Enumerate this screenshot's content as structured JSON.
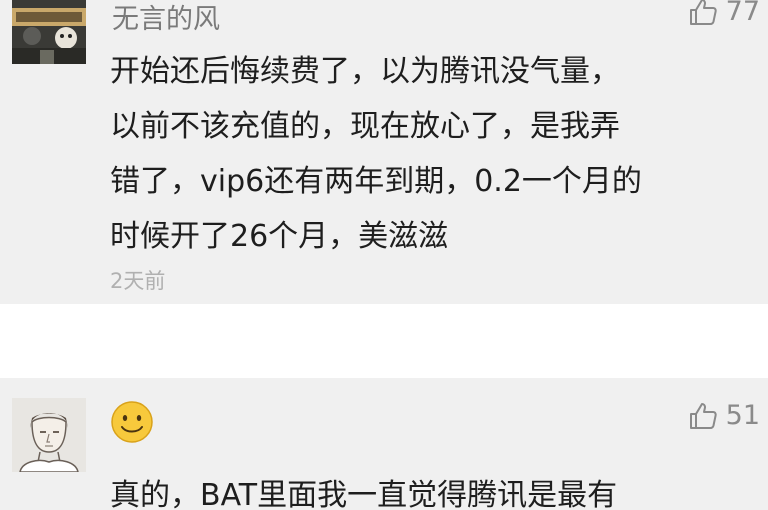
{
  "comments": [
    {
      "username": "无言的风",
      "likes": "77",
      "text": "开始还后悔续费了，以为腾讯没气量，\n以前不该充值的，现在放心了，是我弄\n错了，vip6还有两年到期，0.2一个月的\n时候开了26个月，美滋滋",
      "time": "2天前"
    },
    {
      "likes": "51",
      "text": "真的，BAT里面我一直觉得腾讯是最有"
    }
  ],
  "icons": {
    "like": "thumbs-up-icon",
    "name_emoji": "smiley-emoji-icon"
  },
  "colors": {
    "card_bg": "#f0f0f0",
    "separator_bg": "#ffffff",
    "text": "#1e1e1e",
    "username": "#7a7a7a",
    "meta": "#b0b0b0"
  }
}
